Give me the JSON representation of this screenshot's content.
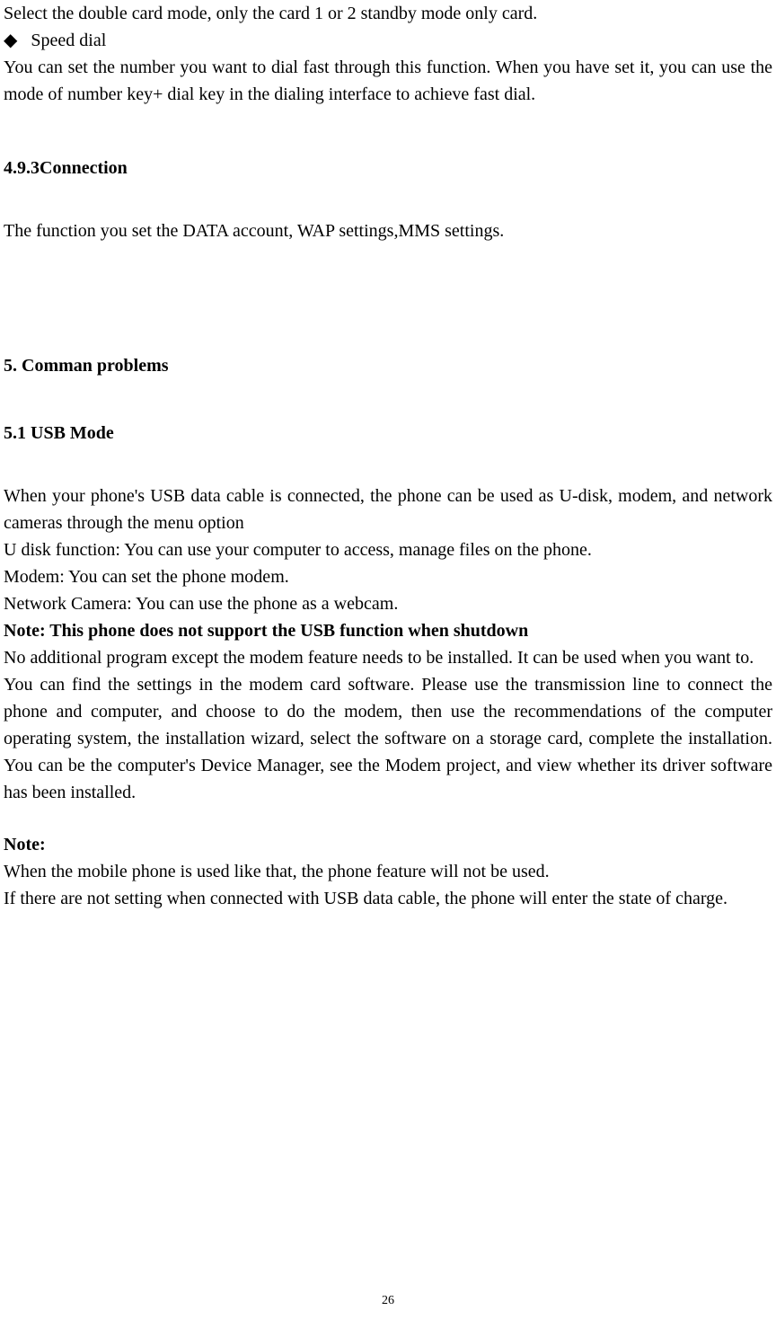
{
  "intro": {
    "line1": "Select the double card mode, only the card 1 or 2 standby mode only card.",
    "bullet_label": "Speed dial",
    "speed_dial_para": "You can set the number you want to dial fast through this function. When you have set it, you can use the mode of number key+ dial key in the dialing interface to achieve fast dial."
  },
  "section493": {
    "heading": "4.9.3Connection",
    "body": "The function you set the DATA account, WAP settings,MMS settings."
  },
  "section5": {
    "heading": "5. Comman problems"
  },
  "section51": {
    "heading": "5.1 USB Mode",
    "para1": "When your phone's USB data cable is connected, the phone can be used as U-disk, modem, and network cameras through the menu option",
    "para2": "U disk function: You can use your computer to access, manage files on the phone.",
    "para3": "Modem: You can set the phone modem.",
    "para4": "Network Camera: You can use the phone as a webcam.",
    "note_bold": "Note: This phone does not support the USB function when shutdown",
    "para5": "No additional program except the modem feature needs to be installed. It can be used when you want to.",
    "para6": "You can find the settings in the modem card software. Please use the transmission line to connect the phone and computer, and choose to do the modem, then use the recommendations of the computer operating system, the installation wizard, select the software on a storage card, complete the installation. You can be the computer's Device Manager, see the Modem project, and view whether its driver software has been installed.",
    "note_label": "Note:",
    "note1": "When the mobile phone is used like that, the phone feature will not be used.",
    "note2": "If there are not setting when connected with USB data cable, the phone will enter the state of charge."
  },
  "page_number": "26"
}
